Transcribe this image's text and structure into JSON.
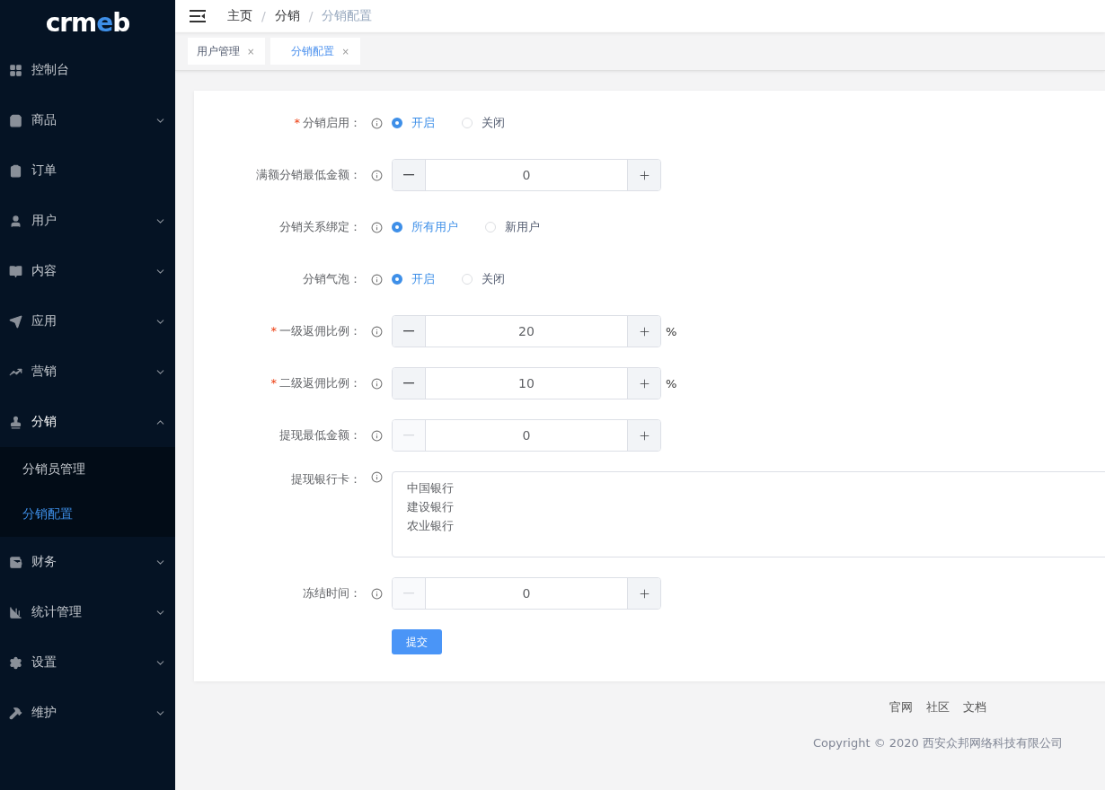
{
  "logo": [
    {
      "text": "crm",
      "accent": false
    },
    {
      "text": "e",
      "accent": true
    },
    {
      "text": "b",
      "accent": false
    }
  ],
  "sidebar": {
    "items": [
      {
        "label": "控制台",
        "kind": "link"
      },
      {
        "label": "商品",
        "kind": "group",
        "expanded": false
      },
      {
        "label": "订单",
        "kind": "link"
      },
      {
        "label": "用户",
        "kind": "group",
        "expanded": false
      },
      {
        "label": "内容",
        "kind": "group",
        "expanded": false
      },
      {
        "label": "应用",
        "kind": "group",
        "expanded": false
      },
      {
        "label": "营销",
        "kind": "group",
        "expanded": false
      },
      {
        "label": "分销",
        "kind": "group",
        "expanded": true,
        "children": [
          {
            "label": "分销员管理",
            "selected": false
          },
          {
            "label": "分销配置",
            "selected": true
          }
        ]
      },
      {
        "label": "财务",
        "kind": "group",
        "expanded": false
      },
      {
        "label": "统计管理",
        "kind": "group",
        "expanded": false
      },
      {
        "label": "设置",
        "kind": "group",
        "expanded": false
      },
      {
        "label": "维护",
        "kind": "group",
        "expanded": false
      }
    ]
  },
  "breadcrumb": [
    {
      "label": "主页",
      "current": false
    },
    {
      "label": "分销",
      "current": false
    },
    {
      "label": "分销配置",
      "current": true
    }
  ],
  "breadcrumb_separator": "/",
  "tabs": [
    {
      "label": "用户管理",
      "close": "×",
      "selected": false
    },
    {
      "label": "分销配置",
      "close": "×",
      "selected": true
    }
  ],
  "form": {
    "rows": [
      {
        "kind": "radio",
        "label": "分销启用：",
        "required": true,
        "options": [
          {
            "label": "开启",
            "selected": true
          },
          {
            "label": "关闭",
            "selected": false
          }
        ]
      },
      {
        "kind": "number",
        "label": "满额分销最低金额：",
        "required": false,
        "value": "0",
        "minus_disabled": false
      },
      {
        "kind": "radio",
        "label": "分销关系绑定：",
        "required": false,
        "options": [
          {
            "label": "所有用户",
            "selected": true
          },
          {
            "label": "新用户",
            "selected": false
          }
        ]
      },
      {
        "kind": "radio",
        "label": "分销气泡：",
        "required": false,
        "options": [
          {
            "label": "开启",
            "selected": true
          },
          {
            "label": "关闭",
            "selected": false
          }
        ]
      },
      {
        "kind": "number",
        "label": "一级返佣比例：",
        "required": true,
        "value": "20",
        "suffix": "%",
        "minus_disabled": false
      },
      {
        "kind": "number",
        "label": "二级返佣比例：",
        "required": true,
        "value": "10",
        "suffix": "%",
        "minus_disabled": false
      },
      {
        "kind": "number",
        "label": "提现最低金额：",
        "required": false,
        "value": "0",
        "minus_disabled": true
      },
      {
        "kind": "textarea",
        "label": "提现银行卡：",
        "required": false,
        "lines": [
          "中国银行",
          "建设银行",
          "农业银行"
        ]
      },
      {
        "kind": "number",
        "label": "冻结时间：",
        "required": false,
        "value": "0",
        "minus_disabled": true
      }
    ],
    "required_mark": "*",
    "submit": "提交"
  },
  "footer": {
    "links": [
      "官网",
      "社区",
      "文档"
    ],
    "copyright": "Copyright © 2020 西安众邦网络科技有限公司"
  }
}
